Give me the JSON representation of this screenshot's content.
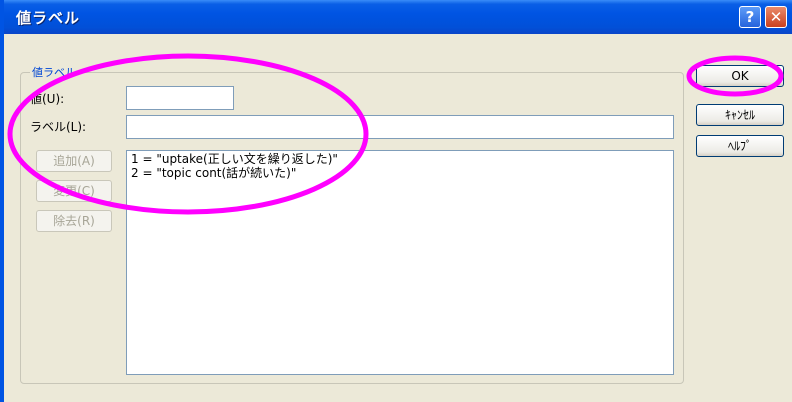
{
  "window": {
    "title": "値ラベル"
  },
  "titlebar": {
    "help_icon": "?",
    "close_icon": "✕"
  },
  "group": {
    "label": "値ラベル"
  },
  "fields": {
    "value_label": "値(U):",
    "value_input": "",
    "label_label": "ラベル(L):",
    "label_input": ""
  },
  "side_buttons": {
    "add": "追加(A)",
    "change": "変更(C)",
    "remove": "除去(R)"
  },
  "list": {
    "items": [
      "1 = \"uptake(正しい文を繰り返した)\"",
      "2 = \"topic cont(話が続いた)\""
    ]
  },
  "buttons": {
    "ok": "OK",
    "cancel": "ｷｬﾝｾﾙ",
    "help": "ﾍﾙﾌﾟ"
  },
  "annotation_color": "#ff00ff"
}
